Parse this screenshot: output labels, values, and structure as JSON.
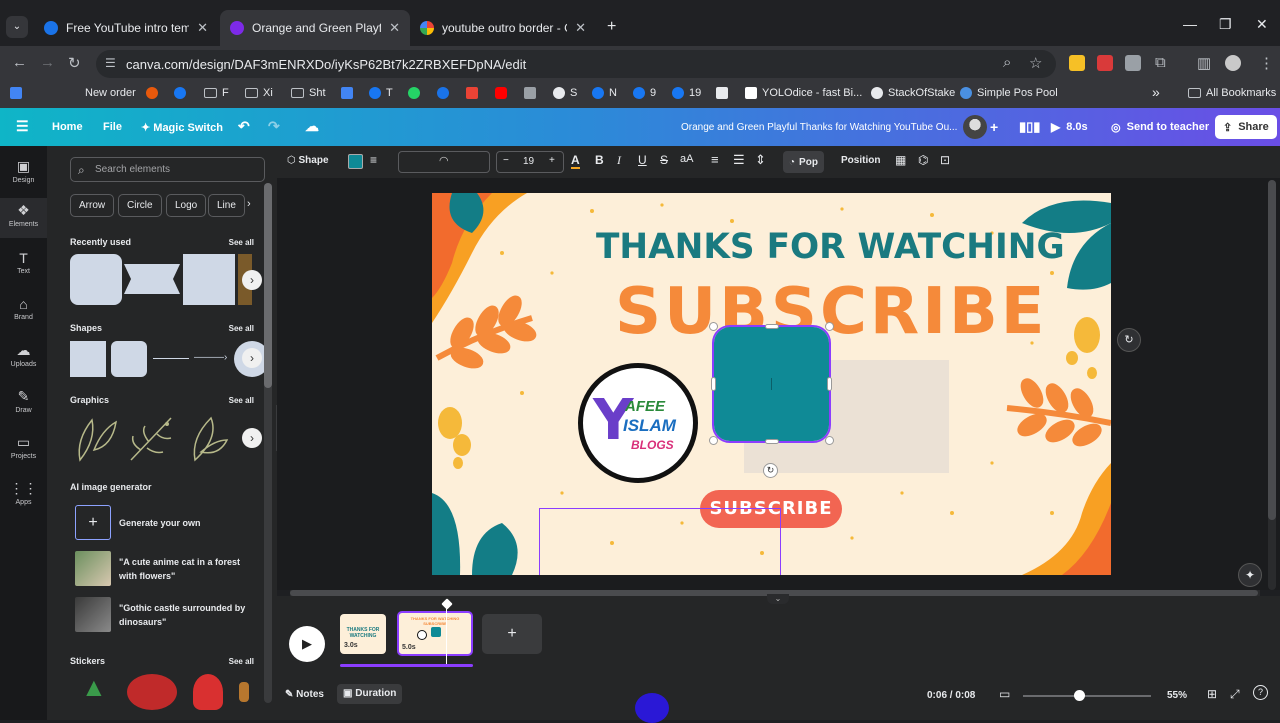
{
  "browser": {
    "tabs": [
      {
        "title": "Free YouTube intro templates to",
        "icon_color": "#1a73e8"
      },
      {
        "title": "Orange and Green Playful Thank",
        "icon_color": "#7d2ae8"
      },
      {
        "title": "youtube outro border - Google",
        "icon_color": "#ffffff"
      }
    ],
    "new_tab": "+",
    "url": "canva.com/design/DAF3mENRXDo/iyKsP62Bt7k2ZRBXEFDpNA/edit",
    "bookmarks": [
      {
        "label": "New order",
        "kind": "plain"
      },
      {
        "label": "",
        "kind": "icon",
        "color": "#e8590c"
      },
      {
        "label": "",
        "kind": "icon",
        "color": "#1877f2"
      },
      {
        "label": "F",
        "kind": "folder"
      },
      {
        "label": "Xi",
        "kind": "folder"
      },
      {
        "label": "Sht",
        "kind": "folder"
      },
      {
        "label": "",
        "kind": "icon",
        "color": "#4285f4"
      },
      {
        "label": "T",
        "kind": "icon",
        "color": "#1877f2"
      },
      {
        "label": "",
        "kind": "icon",
        "color": "#25d366"
      },
      {
        "label": "",
        "kind": "icon",
        "color": "#1a73e8"
      },
      {
        "label": "",
        "kind": "icon",
        "color": "#ea4335"
      },
      {
        "label": "",
        "kind": "icon",
        "color": "#ff0000"
      },
      {
        "label": "",
        "kind": "icon",
        "color": "#9aa0a6"
      },
      {
        "label": "S",
        "kind": "icon",
        "color": "#e8eaed"
      },
      {
        "label": "N",
        "kind": "icon",
        "color": "#1877f2"
      },
      {
        "label": "9",
        "kind": "icon",
        "color": "#1877f2"
      },
      {
        "label": "19",
        "kind": "icon",
        "color": "#1877f2"
      },
      {
        "label": "",
        "kind": "icon",
        "color": "#e8eaed"
      },
      {
        "label": "YOLOdice - fast Bi...",
        "kind": "icon",
        "color": "#ffffff"
      },
      {
        "label": "StackOfStake",
        "kind": "icon",
        "color": "#e8eaed"
      },
      {
        "label": "Simple Pos Pool",
        "kind": "icon",
        "color": "#4a90e2"
      }
    ],
    "all_bookmarks": "All Bookmarks",
    "overflow": "»"
  },
  "canva_header": {
    "home": "Home",
    "file": "File",
    "magic_switch": "Magic Switch",
    "doc_title": "Orange and Green Playful Thanks for Watching YouTube Ou...",
    "duration": "8.0s",
    "send_to_teacher": "Send to teacher",
    "share": "Share"
  },
  "rail": [
    {
      "label": "Design",
      "icon": "▣"
    },
    {
      "label": "Elements",
      "icon": "❖"
    },
    {
      "label": "Text",
      "icon": "T"
    },
    {
      "label": "Brand",
      "icon": "⌂"
    },
    {
      "label": "Uploads",
      "icon": "☁"
    },
    {
      "label": "Draw",
      "icon": "✎"
    },
    {
      "label": "Projects",
      "icon": "▭"
    },
    {
      "label": "Apps",
      "icon": "⋮⋮"
    }
  ],
  "panel": {
    "search_placeholder": "Search elements",
    "chips": [
      "Arrow",
      "Circle",
      "Logo",
      "Line"
    ],
    "recently_used": "Recently used",
    "shapes": "Shapes",
    "graphics": "Graphics",
    "ai_generator": "AI image generator",
    "generate_own": "Generate your own",
    "prompt1": "\"A cute anime cat in a forest with flowers\"",
    "prompt2": "\"Gothic castle surrounded by dinosaurs\"",
    "stickers": "Stickers",
    "see_all": "See all"
  },
  "toolbar": {
    "shape": "Shape",
    "font_size": "19",
    "minus": "−",
    "plus": "+",
    "pop": "Pop",
    "position": "Position",
    "fill_color": "#0f8a96"
  },
  "design": {
    "line1": "THANKS FOR WATCHING",
    "line2": "SUBSCRIBE",
    "button": "SUBSCRIBE",
    "logo_y": "Y",
    "logo_afee": "AFEE",
    "logo_islam": "ISLAM",
    "logo_blogs": "BLOGS",
    "teal": "#0f8a96",
    "orange": "#f58a3a",
    "heading_teal": "#1a7a80"
  },
  "timeline": {
    "page1_label": "THANKS FOR WATCHING",
    "page1_duration": "3.0s",
    "page2_label": "THANKS FOR WATCHING SUBSCRIBE",
    "page2_duration": "5.0s",
    "add_page": "+",
    "notes": "Notes",
    "duration_btn": "Duration",
    "time": "0:06 / 0:08",
    "zoom": "55%"
  }
}
